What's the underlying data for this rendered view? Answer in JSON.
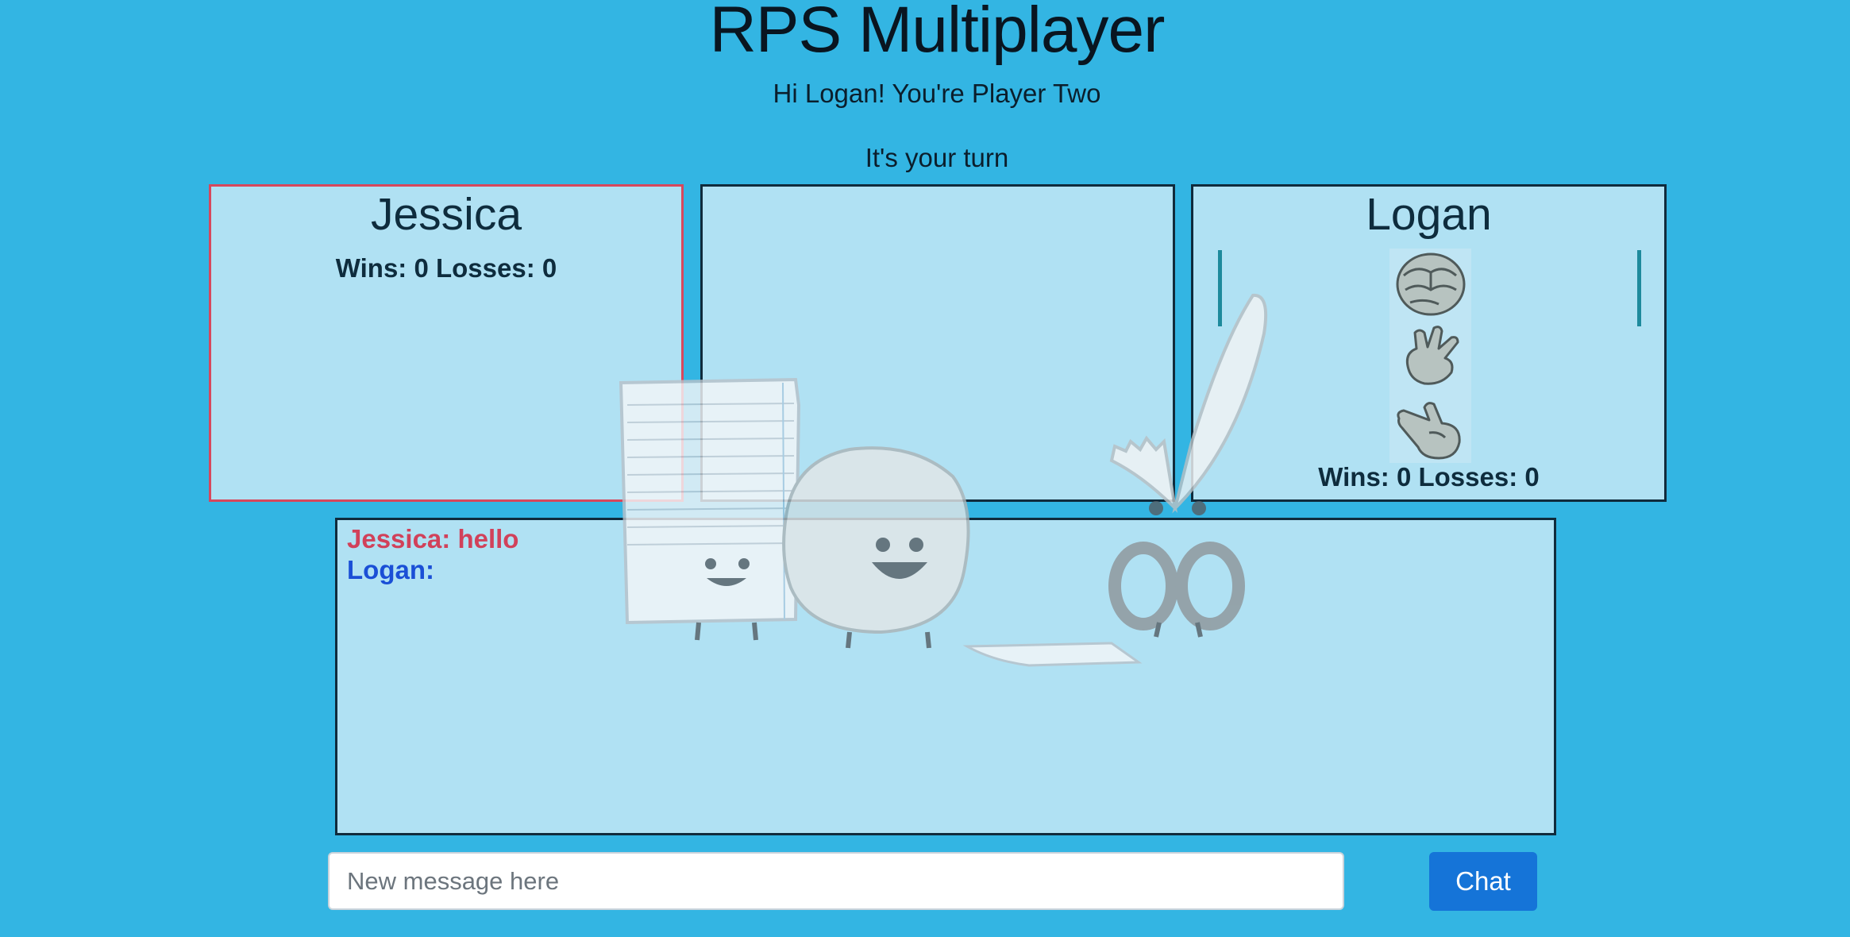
{
  "header": {
    "title": "RPS Multiplayer",
    "greeting": "Hi Logan! You're Player Two",
    "turn_status": "It's your turn"
  },
  "player_one": {
    "name": "Jessica",
    "score": "Wins: 0 Losses: 0"
  },
  "player_two": {
    "name": "Logan",
    "score": "Wins: 0 Losses: 0",
    "choices": [
      {
        "name": "rock",
        "icon": "rock-hand-icon"
      },
      {
        "name": "paper",
        "icon": "paper-hand-icon"
      },
      {
        "name": "scissors",
        "icon": "scissors-hand-icon"
      }
    ]
  },
  "chat": {
    "messages": [
      {
        "text": "Jessica: hello",
        "color": "#d1415a"
      },
      {
        "text": "Logan:",
        "color": "#1a4fd6"
      }
    ],
    "input_placeholder": "New message here",
    "send_label": "Chat"
  },
  "colors": {
    "background": "#33b5e3",
    "active_border": "#d8475c",
    "button": "#1574d8"
  }
}
